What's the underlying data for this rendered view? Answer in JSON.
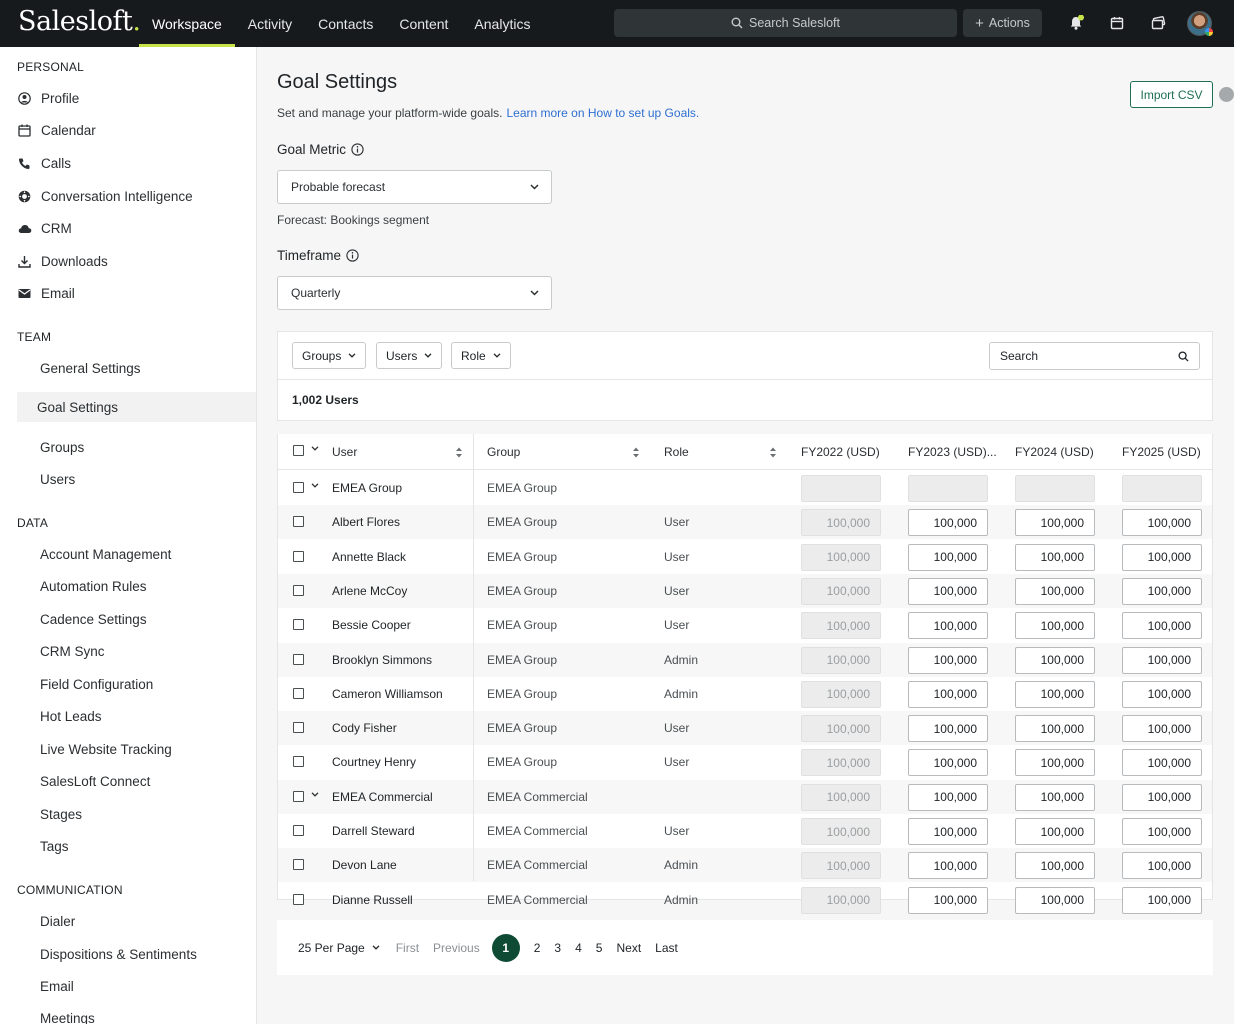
{
  "app": {
    "logo": "Salesloft",
    "logo_dot": "."
  },
  "topnav": {
    "tabs": [
      "Workspace",
      "Activity",
      "Contacts",
      "Content",
      "Analytics"
    ],
    "search_label": "Search Salesloft",
    "actions_label": "Actions"
  },
  "sidebar": {
    "personal": {
      "title": "PERSONAL",
      "items": [
        "Profile",
        "Calendar",
        "Calls",
        "Conversation Intelligence",
        "CRM",
        "Downloads",
        "Email"
      ]
    },
    "team": {
      "title": "TEAM",
      "items": [
        "General Settings",
        "Goal Settings",
        "Groups",
        "Users"
      ]
    },
    "data": {
      "title": "DATA",
      "items": [
        "Account Management",
        "Automation Rules",
        "Cadence Settings",
        "CRM Sync",
        "Field Configuration",
        "Hot Leads",
        "Live Website Tracking",
        "SalesLoft Connect",
        "Stages",
        "Tags"
      ]
    },
    "communication": {
      "title": "COMMUNICATION",
      "items": [
        "Dialer",
        "Dispositions & Sentiments",
        "Email",
        "Meetings"
      ]
    }
  },
  "page": {
    "title": "Goal Settings",
    "subtitle": "Set and manage your platform-wide goals.",
    "learn_link": "Learn more on How to set up Goals.",
    "import_label": "Import CSV",
    "goal_metric_label": "Goal Metric",
    "goal_metric_value": "Probable forecast",
    "helper": "Forecast: Bookings segment",
    "timeframe_label": "Timeframe",
    "timeframe_value": "Quarterly"
  },
  "table": {
    "filters": [
      "Groups",
      "Users",
      "Role"
    ],
    "search_placeholder": "Search",
    "count": "1,002 Users",
    "columns": [
      "User",
      "Group",
      "Role",
      "FY2022 (USD)",
      "FY2023 (USD)...",
      "FY2024 (USD)",
      "FY2025 (USD)"
    ],
    "rows": [
      {
        "user": "EMEA Group",
        "group": "EMEA Group",
        "role": "",
        "is_group": true,
        "values": [
          "",
          "",
          "",
          ""
        ]
      },
      {
        "user": "Albert Flores",
        "group": "EMEA Group",
        "role": "User",
        "is_group": false,
        "values": [
          "100,000",
          "100,000",
          "100,000",
          "100,000"
        ]
      },
      {
        "user": "Annette Black",
        "group": "EMEA Group",
        "role": "User",
        "is_group": false,
        "values": [
          "100,000",
          "100,000",
          "100,000",
          "100,000"
        ]
      },
      {
        "user": "Arlene McCoy",
        "group": "EMEA Group",
        "role": "User",
        "is_group": false,
        "values": [
          "100,000",
          "100,000",
          "100,000",
          "100,000"
        ]
      },
      {
        "user": "Bessie Cooper",
        "group": "EMEA Group",
        "role": "User",
        "is_group": false,
        "values": [
          "100,000",
          "100,000",
          "100,000",
          "100,000"
        ]
      },
      {
        "user": "Brooklyn Simmons",
        "group": "EMEA Group",
        "role": "Admin",
        "is_group": false,
        "values": [
          "100,000",
          "100,000",
          "100,000",
          "100,000"
        ]
      },
      {
        "user": "Cameron Williamson",
        "group": "EMEA Group",
        "role": "Admin",
        "is_group": false,
        "values": [
          "100,000",
          "100,000",
          "100,000",
          "100,000"
        ]
      },
      {
        "user": "Cody Fisher",
        "group": "EMEA Group",
        "role": "User",
        "is_group": false,
        "values": [
          "100,000",
          "100,000",
          "100,000",
          "100,000"
        ]
      },
      {
        "user": "Courtney Henry",
        "group": "EMEA Group",
        "role": "User",
        "is_group": false,
        "values": [
          "100,000",
          "100,000",
          "100,000",
          "100,000"
        ]
      },
      {
        "user": "EMEA Commercial",
        "group": "EMEA Commercial",
        "role": "",
        "is_group": true,
        "values": [
          "100,000",
          "100,000",
          "100,000",
          "100,000"
        ]
      },
      {
        "user": "Darrell Steward",
        "group": "EMEA Commercial",
        "role": "User",
        "is_group": false,
        "values": [
          "100,000",
          "100,000",
          "100,000",
          "100,000"
        ]
      },
      {
        "user": "Devon Lane",
        "group": "EMEA Commercial",
        "role": "Admin",
        "is_group": false,
        "values": [
          "100,000",
          "100,000",
          "100,000",
          "100,000"
        ]
      },
      {
        "user": "Dianne Russell",
        "group": "EMEA Commercial",
        "role": "Admin",
        "is_group": false,
        "values": [
          "100,000",
          "100,000",
          "100,000",
          "100,000"
        ]
      }
    ]
  },
  "pagination": {
    "per_page": "25 Per Page",
    "first": "First",
    "previous": "Previous",
    "pages": [
      "1",
      "2",
      "3",
      "4",
      "5"
    ],
    "current": "1",
    "next": "Next",
    "last": "Last"
  },
  "colors": {
    "accent": "#c7e34a",
    "brand_green": "#0e4a34",
    "nav_bg": "#161a1d",
    "link": "#2f6fd1"
  }
}
